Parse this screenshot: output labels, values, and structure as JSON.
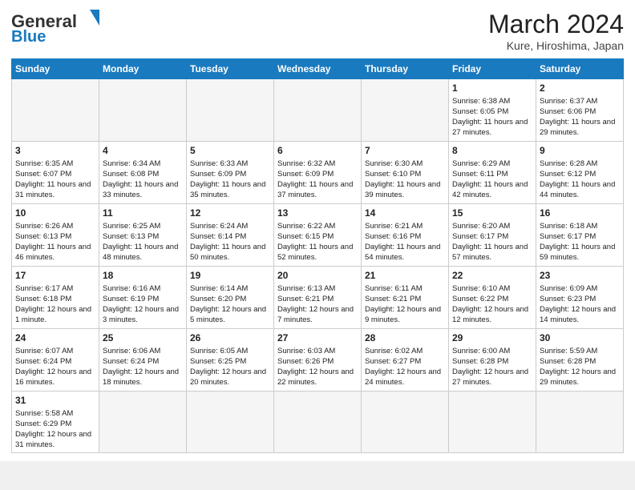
{
  "header": {
    "logo_general": "General",
    "logo_blue": "Blue",
    "month_year": "March 2024",
    "location": "Kure, Hiroshima, Japan"
  },
  "days_of_week": [
    "Sunday",
    "Monday",
    "Tuesday",
    "Wednesday",
    "Thursday",
    "Friday",
    "Saturday"
  ],
  "weeks": [
    [
      {
        "day": "",
        "info": "",
        "empty": true
      },
      {
        "day": "",
        "info": "",
        "empty": true
      },
      {
        "day": "",
        "info": "",
        "empty": true
      },
      {
        "day": "",
        "info": "",
        "empty": true
      },
      {
        "day": "",
        "info": "",
        "empty": true
      },
      {
        "day": "1",
        "info": "Sunrise: 6:38 AM\nSunset: 6:05 PM\nDaylight: 11 hours\nand 27 minutes."
      },
      {
        "day": "2",
        "info": "Sunrise: 6:37 AM\nSunset: 6:06 PM\nDaylight: 11 hours\nand 29 minutes."
      }
    ],
    [
      {
        "day": "3",
        "info": "Sunrise: 6:35 AM\nSunset: 6:07 PM\nDaylight: 11 hours\nand 31 minutes."
      },
      {
        "day": "4",
        "info": "Sunrise: 6:34 AM\nSunset: 6:08 PM\nDaylight: 11 hours\nand 33 minutes."
      },
      {
        "day": "5",
        "info": "Sunrise: 6:33 AM\nSunset: 6:09 PM\nDaylight: 11 hours\nand 35 minutes."
      },
      {
        "day": "6",
        "info": "Sunrise: 6:32 AM\nSunset: 6:09 PM\nDaylight: 11 hours\nand 37 minutes."
      },
      {
        "day": "7",
        "info": "Sunrise: 6:30 AM\nSunset: 6:10 PM\nDaylight: 11 hours\nand 39 minutes."
      },
      {
        "day": "8",
        "info": "Sunrise: 6:29 AM\nSunset: 6:11 PM\nDaylight: 11 hours\nand 42 minutes."
      },
      {
        "day": "9",
        "info": "Sunrise: 6:28 AM\nSunset: 6:12 PM\nDaylight: 11 hours\nand 44 minutes."
      }
    ],
    [
      {
        "day": "10",
        "info": "Sunrise: 6:26 AM\nSunset: 6:13 PM\nDaylight: 11 hours\nand 46 minutes."
      },
      {
        "day": "11",
        "info": "Sunrise: 6:25 AM\nSunset: 6:13 PM\nDaylight: 11 hours\nand 48 minutes."
      },
      {
        "day": "12",
        "info": "Sunrise: 6:24 AM\nSunset: 6:14 PM\nDaylight: 11 hours\nand 50 minutes."
      },
      {
        "day": "13",
        "info": "Sunrise: 6:22 AM\nSunset: 6:15 PM\nDaylight: 11 hours\nand 52 minutes."
      },
      {
        "day": "14",
        "info": "Sunrise: 6:21 AM\nSunset: 6:16 PM\nDaylight: 11 hours\nand 54 minutes."
      },
      {
        "day": "15",
        "info": "Sunrise: 6:20 AM\nSunset: 6:17 PM\nDaylight: 11 hours\nand 57 minutes."
      },
      {
        "day": "16",
        "info": "Sunrise: 6:18 AM\nSunset: 6:17 PM\nDaylight: 11 hours\nand 59 minutes."
      }
    ],
    [
      {
        "day": "17",
        "info": "Sunrise: 6:17 AM\nSunset: 6:18 PM\nDaylight: 12 hours\nand 1 minute."
      },
      {
        "day": "18",
        "info": "Sunrise: 6:16 AM\nSunset: 6:19 PM\nDaylight: 12 hours\nand 3 minutes."
      },
      {
        "day": "19",
        "info": "Sunrise: 6:14 AM\nSunset: 6:20 PM\nDaylight: 12 hours\nand 5 minutes."
      },
      {
        "day": "20",
        "info": "Sunrise: 6:13 AM\nSunset: 6:21 PM\nDaylight: 12 hours\nand 7 minutes."
      },
      {
        "day": "21",
        "info": "Sunrise: 6:11 AM\nSunset: 6:21 PM\nDaylight: 12 hours\nand 9 minutes."
      },
      {
        "day": "22",
        "info": "Sunrise: 6:10 AM\nSunset: 6:22 PM\nDaylight: 12 hours\nand 12 minutes."
      },
      {
        "day": "23",
        "info": "Sunrise: 6:09 AM\nSunset: 6:23 PM\nDaylight: 12 hours\nand 14 minutes."
      }
    ],
    [
      {
        "day": "24",
        "info": "Sunrise: 6:07 AM\nSunset: 6:24 PM\nDaylight: 12 hours\nand 16 minutes."
      },
      {
        "day": "25",
        "info": "Sunrise: 6:06 AM\nSunset: 6:24 PM\nDaylight: 12 hours\nand 18 minutes."
      },
      {
        "day": "26",
        "info": "Sunrise: 6:05 AM\nSunset: 6:25 PM\nDaylight: 12 hours\nand 20 minutes."
      },
      {
        "day": "27",
        "info": "Sunrise: 6:03 AM\nSunset: 6:26 PM\nDaylight: 12 hours\nand 22 minutes."
      },
      {
        "day": "28",
        "info": "Sunrise: 6:02 AM\nSunset: 6:27 PM\nDaylight: 12 hours\nand 24 minutes."
      },
      {
        "day": "29",
        "info": "Sunrise: 6:00 AM\nSunset: 6:28 PM\nDaylight: 12 hours\nand 27 minutes."
      },
      {
        "day": "30",
        "info": "Sunrise: 5:59 AM\nSunset: 6:28 PM\nDaylight: 12 hours\nand 29 minutes."
      }
    ],
    [
      {
        "day": "31",
        "info": "Sunrise: 5:58 AM\nSunset: 6:29 PM\nDaylight: 12 hours\nand 31 minutes."
      },
      {
        "day": "",
        "info": "",
        "empty": true
      },
      {
        "day": "",
        "info": "",
        "empty": true
      },
      {
        "day": "",
        "info": "",
        "empty": true
      },
      {
        "day": "",
        "info": "",
        "empty": true
      },
      {
        "day": "",
        "info": "",
        "empty": true
      },
      {
        "day": "",
        "info": "",
        "empty": true
      }
    ]
  ]
}
